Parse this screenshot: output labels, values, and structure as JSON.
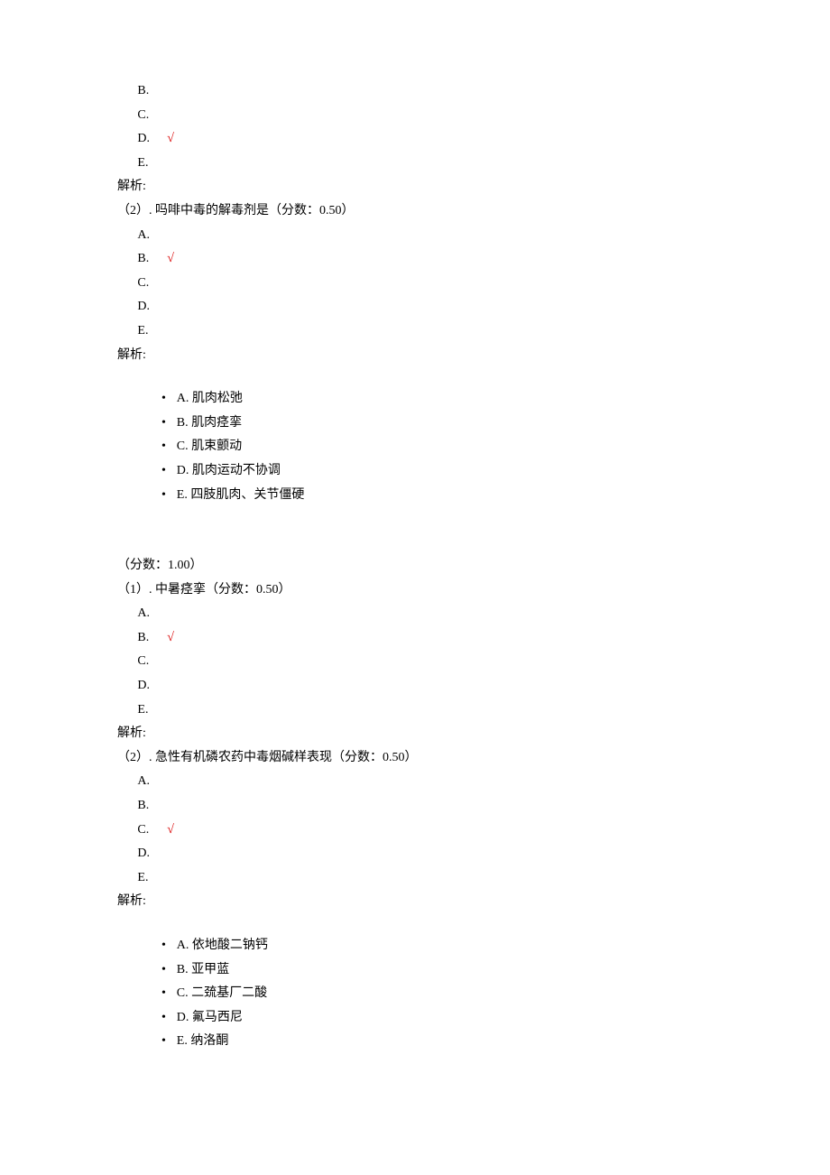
{
  "labels": {
    "explain": "解析:",
    "check": "√"
  },
  "letters": {
    "A": "A.",
    "B": "B.",
    "C": "C.",
    "D": "D.",
    "E": "E."
  },
  "block1": {
    "opts": [
      {
        "letter": "B.",
        "correct": false
      },
      {
        "letter": "C.",
        "correct": false
      },
      {
        "letter": "D.",
        "correct": true
      },
      {
        "letter": "E.",
        "correct": false
      }
    ]
  },
  "q2": {
    "prompt": "（2）. 吗啡中毒的解毒剂是（分数：0.50）",
    "opts": [
      {
        "letter": "A.",
        "correct": false
      },
      {
        "letter": "B.",
        "correct": true
      },
      {
        "letter": "C.",
        "correct": false
      },
      {
        "letter": "D.",
        "correct": false
      },
      {
        "letter": "E.",
        "correct": false
      }
    ]
  },
  "choiceGroup1": {
    "items": [
      "A. 肌肉松弛",
      "B. 肌肉痉挛",
      "C. 肌束颤动",
      "D. 肌肉运动不协调",
      "E. 四肢肌肉、关节僵硬"
    ]
  },
  "score": "（分数：1.00）",
  "q3": {
    "prompt": "（1）. 中暑痉挛（分数：0.50）",
    "opts": [
      {
        "letter": "A.",
        "correct": false
      },
      {
        "letter": "B.",
        "correct": true
      },
      {
        "letter": "C.",
        "correct": false
      },
      {
        "letter": "D.",
        "correct": false
      },
      {
        "letter": "E.",
        "correct": false
      }
    ]
  },
  "q4": {
    "prompt": "（2）. 急性有机磷农药中毒烟碱样表现（分数：0.50）",
    "opts": [
      {
        "letter": "A.",
        "correct": false
      },
      {
        "letter": "B.",
        "correct": false
      },
      {
        "letter": "C.",
        "correct": true
      },
      {
        "letter": "D.",
        "correct": false
      },
      {
        "letter": "E.",
        "correct": false
      }
    ]
  },
  "choiceGroup2": {
    "items": [
      "A. 依地酸二钠钙",
      "B. 亚甲蓝",
      "C. 二巯基厂二酸",
      "D. 氟马西尼",
      "E. 纳洛酮"
    ]
  }
}
